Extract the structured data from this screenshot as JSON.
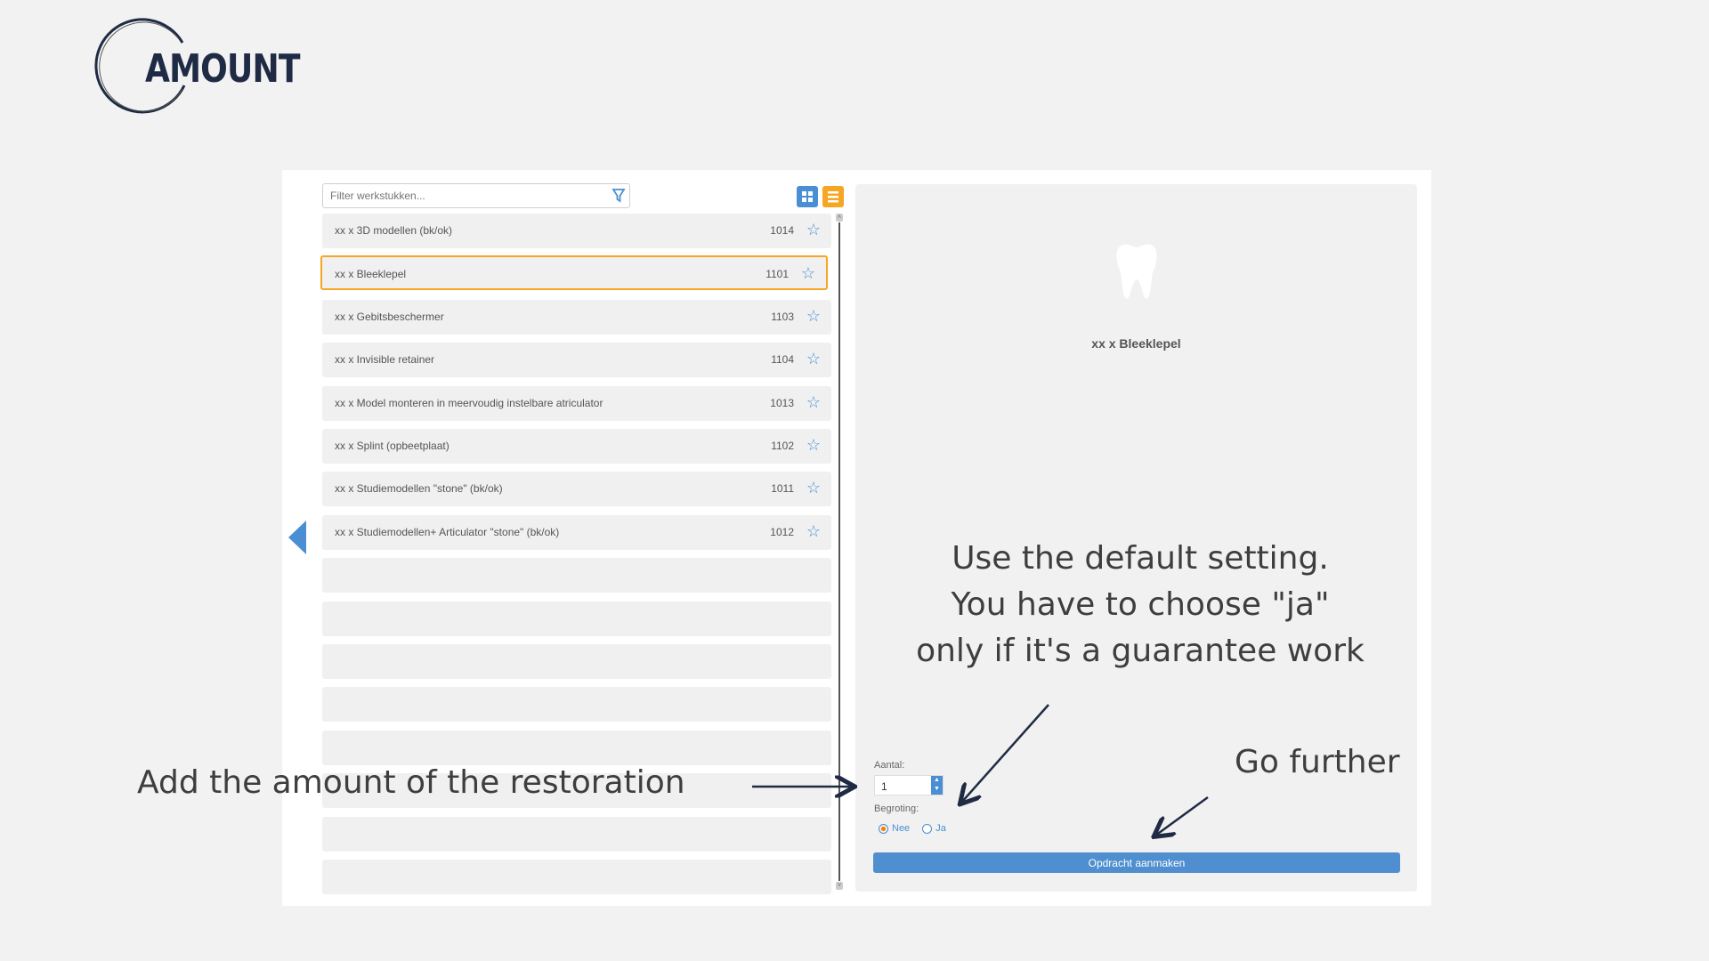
{
  "logo": {
    "text": "AMOUNT"
  },
  "search": {
    "placeholder": "Filter werkstukken..."
  },
  "view_toggle": {
    "grid_color": "#4a8fd4",
    "list_color": "#f5a623"
  },
  "list": {
    "items": [
      {
        "label": "xx x 3D modellen (bk/ok)",
        "code": "1014"
      },
      {
        "label": "xx x Bleeklepel",
        "code": "1101",
        "selected": true
      },
      {
        "label": "xx x Gebitsbeschermer",
        "code": "1103"
      },
      {
        "label": "xx x Invisible retainer",
        "code": "1104"
      },
      {
        "label": "xx x Model monteren in meervoudig instelbare atriculator",
        "code": "1013"
      },
      {
        "label": "xx x Splint (opbeetplaat)",
        "code": "1102"
      },
      {
        "label": "xx x Studiemodellen \"stone\" (bk/ok)",
        "code": "1011"
      },
      {
        "label": "xx x Studiemodellen+ Articulator \"stone\" (bk/ok)",
        "code": "1012"
      }
    ],
    "empty_rows": 8
  },
  "detail": {
    "title": "xx x Bleeklepel",
    "aantal_label": "Aantal:",
    "aantal_value": "1",
    "begroting_label": "Begroting:",
    "options": [
      "Nee",
      "Ja"
    ],
    "selected": "Nee",
    "submit": "Opdracht aanmaken"
  },
  "annotations": {
    "default_setting": [
      "Use the default setting.",
      "You have to choose \"ja\"",
      "only if it's a guarantee work"
    ],
    "go_further": "Go further",
    "amount": "Add the amount of the restoration"
  }
}
